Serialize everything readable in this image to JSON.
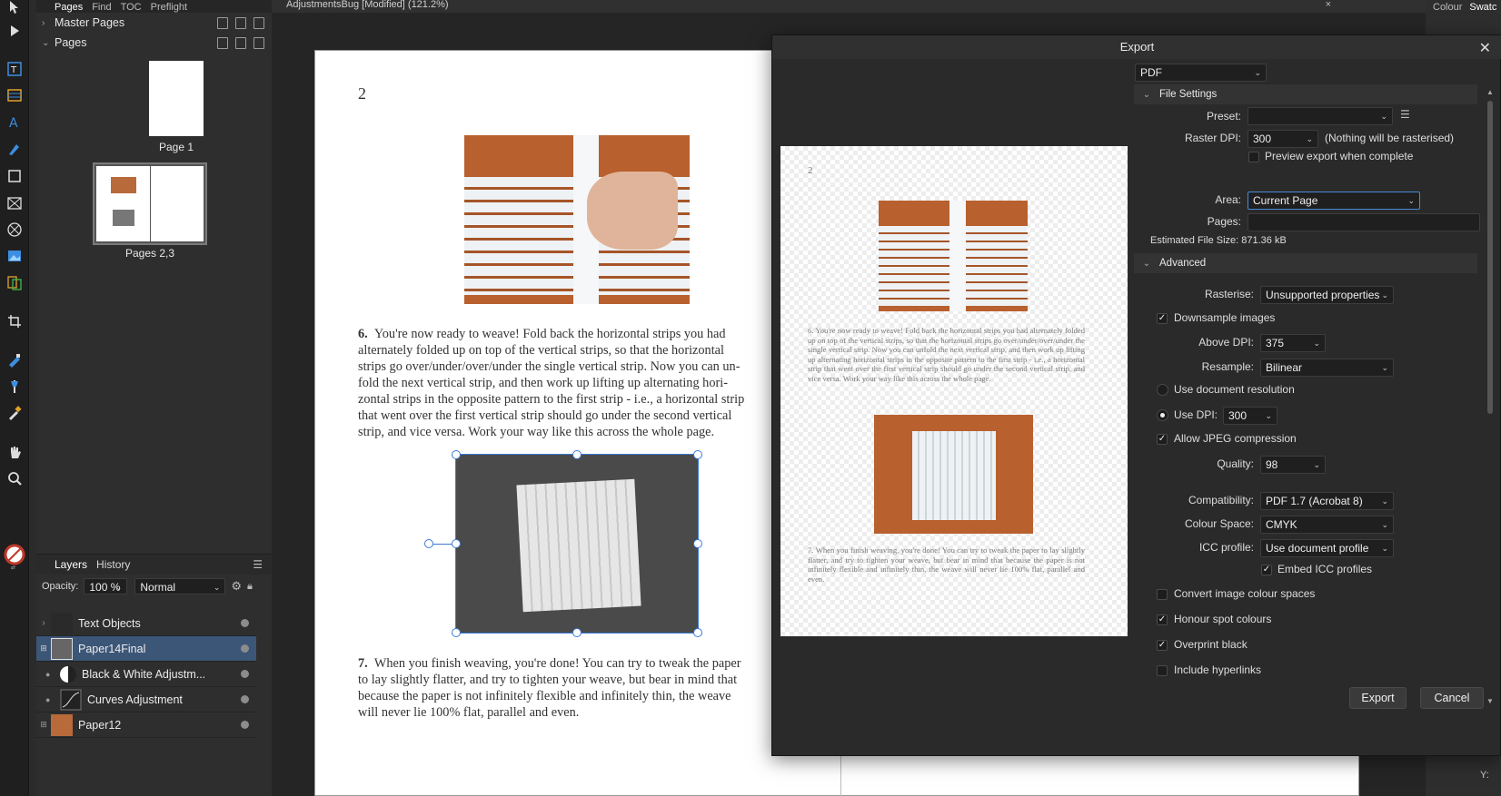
{
  "left_panel": {
    "tabs": [
      "Pages",
      "Find",
      "TOC",
      "Preflight"
    ],
    "master_pages_label": "Master Pages",
    "pages_label": "Pages",
    "page1_label": "Page 1",
    "spread_label": "Pages 2,3"
  },
  "layers_panel": {
    "tabs": [
      "Layers",
      "History"
    ],
    "opacity_label": "Opacity:",
    "opacity_value": "100 %",
    "blend_mode": "Normal",
    "layers": [
      {
        "name": "Text Objects"
      },
      {
        "name": "Paper14Final"
      },
      {
        "name": "Black & White Adjustm..."
      },
      {
        "name": "Curves Adjustment"
      },
      {
        "name": "Paper12"
      }
    ]
  },
  "document": {
    "tab_title": "AdjustmentsBug [Modified] (121.2%)",
    "page_number": "2",
    "step6_num": "6.",
    "step6_lines": [
      "You're now ready to weave! Fold back the horizontal strips you had",
      "alternately folded up on top of the vertical strips, so that the horizontal",
      "strips go over/under/over/under the single vertical strip. Now you can un-",
      "fold the next vertical strip, and then work up lifting up alternating hori-",
      "zontal strips in the opposite pattern to the first strip - i.e., a horizontal strip",
      "that went over the first vertical strip should go under the second vertical",
      "strip, and vice versa. Work your way like this across the whole page."
    ],
    "step7_num": "7.",
    "step7_lines": [
      "When you finish weaving, you're done! You can try to tweak the paper",
      "to lay slightly flatter, and try to tighten your weave, but bear in mind that",
      "because the paper is not infinitely flexible and infinitely thin, the weave",
      "will never lie 100% flat, parallel and even."
    ]
  },
  "right_panel": {
    "tabs": [
      "Colour",
      "Swatc"
    ],
    "y_label": "Y:"
  },
  "export_dialog": {
    "title": "Export",
    "format": "PDF",
    "file_settings_label": "File Settings",
    "preset_label": "Preset:",
    "preset_value": "",
    "raster_dpi_label": "Raster DPI:",
    "raster_dpi_value": "300",
    "raster_note": "(Nothing will be rasterised)",
    "preview_export_label": "Preview export when complete",
    "area_label": "Area:",
    "area_value": "Current Page",
    "pages_label": "Pages:",
    "pages_value": "",
    "estimated_size": "Estimated File Size: 871.36 kB",
    "advanced_label": "Advanced",
    "rasterise_label": "Rasterise:",
    "rasterise_value": "Unsupported properties",
    "downsample_label": "Downsample images",
    "above_dpi_label": "Above DPI:",
    "above_dpi_value": "375",
    "resample_label": "Resample:",
    "resample_value": "Bilinear",
    "use_doc_res_label": "Use document resolution",
    "use_dpi_label": "Use DPI:",
    "use_dpi_value": "300",
    "allow_jpeg_label": "Allow JPEG compression",
    "quality_label": "Quality:",
    "quality_value": "98",
    "compatibility_label": "Compatibility:",
    "compatibility_value": "PDF 1.7 (Acrobat 8)",
    "colour_space_label": "Colour Space:",
    "colour_space_value": "CMYK",
    "icc_label": "ICC profile:",
    "icc_value": "Use document profile",
    "embed_icc_label": "Embed ICC profiles",
    "convert_colour_label": "Convert image colour spaces",
    "honour_spot_label": "Honour spot colours",
    "overprint_label": "Overprint black",
    "hyperlinks_label": "Include hyperlinks",
    "export_button": "Export",
    "cancel_button": "Cancel",
    "preview_page_number": "2",
    "preview_step6": "6. You're now ready to weave! Fold back the horizontal strips you had alternately folded up on top of the vertical strips, so that the horizontal strips go over/under/over/under the single vertical strip. Now you can unfold the next vertical strip, and then work up lifting up alternating horizontal strips in the opposite pattern to the first strip - i.e., a horizontal strip that went over the first vertical strip should go under the second vertical strip, and vice versa. Work your way like this across the whole page.",
    "preview_step7": "7. When you finish weaving, you're done! You can try to tweak the paper to lay slightly flatter, and try to tighten your weave, but bear in mind that because the paper is not infinitely flexible and infinitely thin, the weave will never lie 100% flat, parallel and even."
  },
  "colors": {
    "selection": "#3c5678",
    "accent": "#4a8bd8",
    "handle": "#3a7bd5"
  }
}
